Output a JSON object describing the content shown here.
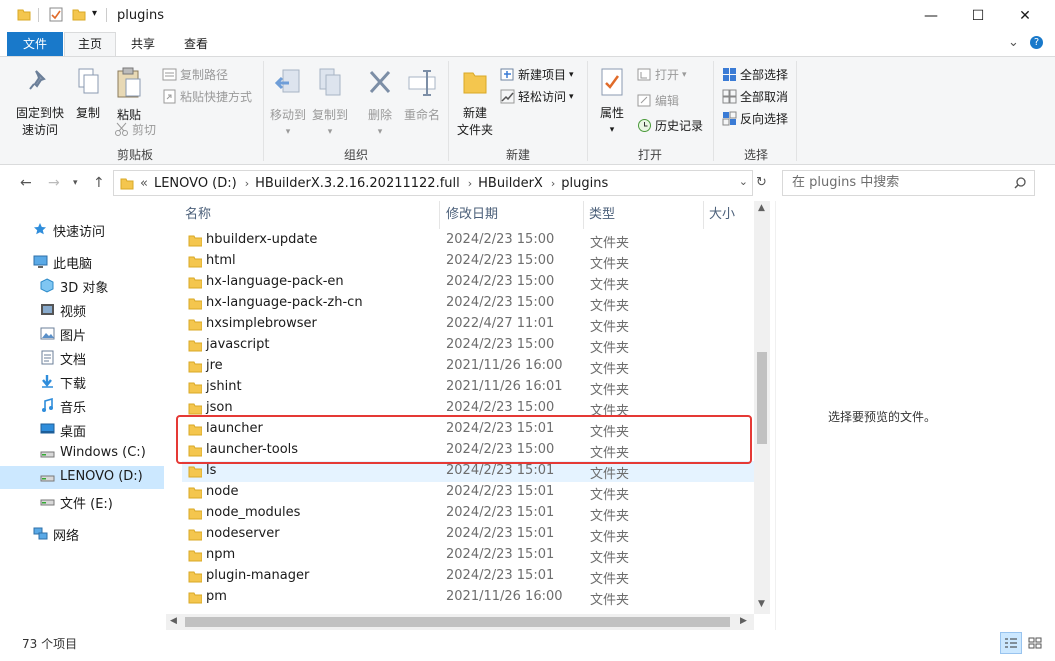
{
  "window": {
    "title": "plugins",
    "minimize_glyph": "—",
    "maximize_glyph": "☐",
    "close_glyph": "✕",
    "help_glyph": "?",
    "collapse_glyph": "⌄"
  },
  "ribbon_tabs": [
    "文件",
    "主页",
    "共享",
    "查看"
  ],
  "ribbon": {
    "clipboard": {
      "label": "剪贴板",
      "pin": "固定到快\n速访问",
      "copy": "复制",
      "paste": "粘贴",
      "copy_path": "复制路径",
      "paste_shortcut": "粘贴快捷方式",
      "cut": "剪切"
    },
    "organize": {
      "label": "组织",
      "move_to": "移动到",
      "copy_to": "复制到",
      "delete": "删除",
      "rename": "重命名"
    },
    "new": {
      "label": "新建",
      "new_folder": "新建\n文件夹",
      "new_item": "新建项目",
      "easy_access": "轻松访问"
    },
    "open": {
      "label": "打开",
      "properties": "属性",
      "open": "打开",
      "edit": "编辑",
      "history": "历史记录"
    },
    "select": {
      "label": "选择",
      "select_all": "全部选择",
      "select_none": "全部取消",
      "invert": "反向选择"
    }
  },
  "address": {
    "prefix": "«",
    "crumbs": [
      "LENOVO (D:)",
      "HBuilderX.3.2.16.20211122.full",
      "HBuilderX",
      "plugins"
    ],
    "search_placeholder": "在 plugins 中搜索"
  },
  "nav_pane": {
    "items": [
      {
        "label": "快速访问",
        "icon": "star-icon",
        "indent": 1,
        "selected": false
      },
      {
        "label": "此电脑",
        "icon": "computer-icon",
        "indent": 1,
        "selected": false
      },
      {
        "label": "3D 对象",
        "icon": "3d-objects-icon",
        "indent": 2,
        "selected": false
      },
      {
        "label": "视频",
        "icon": "video-icon",
        "indent": 2,
        "selected": false
      },
      {
        "label": "图片",
        "icon": "pictures-icon",
        "indent": 2,
        "selected": false
      },
      {
        "label": "文档",
        "icon": "documents-icon",
        "indent": 2,
        "selected": false
      },
      {
        "label": "下载",
        "icon": "download-icon",
        "indent": 2,
        "selected": false
      },
      {
        "label": "音乐",
        "icon": "music-icon",
        "indent": 2,
        "selected": false
      },
      {
        "label": "桌面",
        "icon": "desktop-icon",
        "indent": 2,
        "selected": false
      },
      {
        "label": "Windows (C:)",
        "icon": "drive-icon",
        "indent": 2,
        "selected": false
      },
      {
        "label": "LENOVO (D:)",
        "icon": "drive-icon",
        "indent": 2,
        "selected": true
      },
      {
        "label": "文件 (E:)",
        "icon": "drive-icon",
        "indent": 2,
        "selected": false
      },
      {
        "label": "网络",
        "icon": "network-icon",
        "indent": 1,
        "selected": false
      }
    ]
  },
  "columns": {
    "name": "名称",
    "date": "修改日期",
    "type": "类型",
    "size": "大小"
  },
  "files": [
    {
      "name": "hbuilderx-update",
      "date": "2024/2/23 15:00",
      "type": "文件夹"
    },
    {
      "name": "html",
      "date": "2024/2/23 15:00",
      "type": "文件夹"
    },
    {
      "name": "hx-language-pack-en",
      "date": "2024/2/23 15:00",
      "type": "文件夹"
    },
    {
      "name": "hx-language-pack-zh-cn",
      "date": "2024/2/23 15:00",
      "type": "文件夹"
    },
    {
      "name": "hxsimplebrowser",
      "date": "2022/4/27 11:01",
      "type": "文件夹"
    },
    {
      "name": "javascript",
      "date": "2024/2/23 15:00",
      "type": "文件夹"
    },
    {
      "name": "jre",
      "date": "2021/11/26 16:00",
      "type": "文件夹"
    },
    {
      "name": "jshint",
      "date": "2021/11/26 16:01",
      "type": "文件夹"
    },
    {
      "name": "json",
      "date": "2024/2/23 15:00",
      "type": "文件夹"
    },
    {
      "name": "launcher",
      "date": "2024/2/23 15:01",
      "type": "文件夹"
    },
    {
      "name": "launcher-tools",
      "date": "2024/2/23 15:00",
      "type": "文件夹"
    },
    {
      "name": "ls",
      "date": "2024/2/23 15:01",
      "type": "文件夹"
    },
    {
      "name": "node",
      "date": "2024/2/23 15:01",
      "type": "文件夹"
    },
    {
      "name": "node_modules",
      "date": "2024/2/23 15:01",
      "type": "文件夹"
    },
    {
      "name": "nodeserver",
      "date": "2024/2/23 15:01",
      "type": "文件夹"
    },
    {
      "name": "npm",
      "date": "2024/2/23 15:01",
      "type": "文件夹"
    },
    {
      "name": "plugin-manager",
      "date": "2024/2/23 15:01",
      "type": "文件夹"
    },
    {
      "name": "pm",
      "date": "2021/11/26 16:00",
      "type": "文件夹"
    }
  ],
  "hover_row_index": 11,
  "preview": {
    "text": "选择要预览的文件。"
  },
  "status": {
    "item_count": "73 个项目"
  },
  "colors": {
    "accent": "#1979ca",
    "selection": "#cce8ff",
    "highlight_box": "#e53935",
    "folder": "#f4c64e"
  }
}
